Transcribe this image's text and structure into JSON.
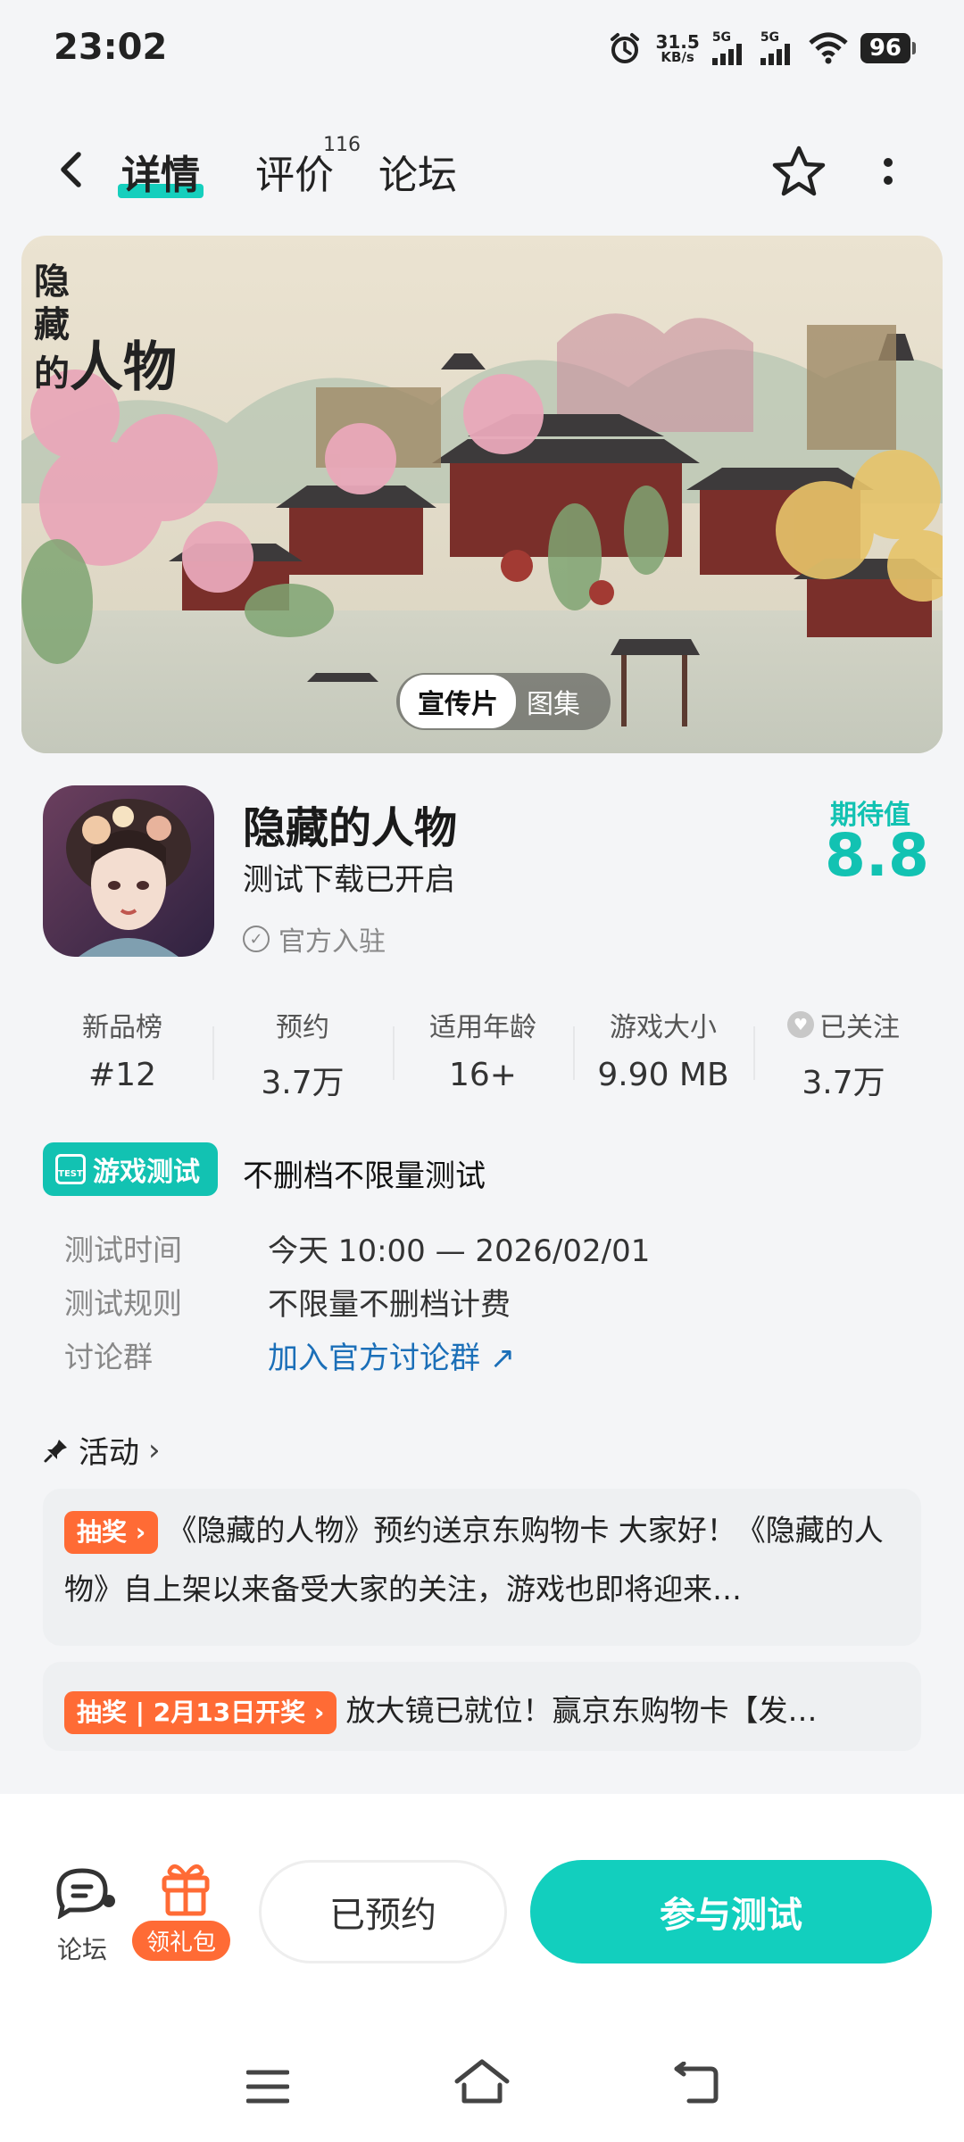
{
  "status_bar": {
    "time": "23:02",
    "net_speed_value": "31.5",
    "net_speed_unit": "KB/s",
    "sim1_label": "5G",
    "sim2_label": "5G",
    "battery": "96",
    "icons": [
      "alarm-icon",
      "signal-icon",
      "signal-icon",
      "wifi-icon",
      "battery-icon"
    ]
  },
  "header": {
    "tabs": [
      {
        "label": "详情",
        "active": true
      },
      {
        "label": "评价",
        "count": "116"
      },
      {
        "label": "论坛"
      }
    ]
  },
  "banner": {
    "title_lines": [
      "隐",
      "藏",
      "的"
    ],
    "title_big": "人物",
    "media_tabs": [
      "宣传片",
      "图集"
    ]
  },
  "app": {
    "name": "隐藏的人物",
    "subtitle": "测试下载已开启",
    "official": "官方入驻",
    "expect_label": "期待值",
    "expect_score": "8.8"
  },
  "stats": [
    {
      "label": "新品榜",
      "value": "#12"
    },
    {
      "label": "预约",
      "value": "3.7万"
    },
    {
      "label": "适用年龄",
      "value": "16+"
    },
    {
      "label": "游戏大小",
      "value": "9.90 MB"
    },
    {
      "label": "已关注",
      "value": "3.7万"
    }
  ],
  "test": {
    "tag": "游戏测试",
    "tag_icon_text": "TEST",
    "title": "不删档不限量测试",
    "rows": [
      {
        "key": "测试时间",
        "value": "今天 10:00 — 2026/02/01"
      },
      {
        "key": "测试规则",
        "value": "不限量不删档计费"
      },
      {
        "key": "讨论群",
        "value": "加入官方讨论群"
      }
    ]
  },
  "activities": {
    "heading": "活动",
    "items": [
      {
        "tag": "抽奖",
        "text": "《隐藏的人物》预约送京东购物卡 大家好！《隐藏的人物》自上架以来备受大家的关注，游戏也即将迎来…"
      },
      {
        "tag": "抽奖 | 2月13日开奖",
        "text": "放大镜已就位！赢京东购物卡【发…"
      }
    ]
  },
  "bottom_bar": {
    "forum_label": "论坛",
    "gift_label": "领礼包",
    "reserved_label": "已预约",
    "join_label": "参与测试"
  },
  "colors": {
    "accent": "#12c2b2",
    "orange": "#ff6b35",
    "link": "#1b6fb8"
  }
}
